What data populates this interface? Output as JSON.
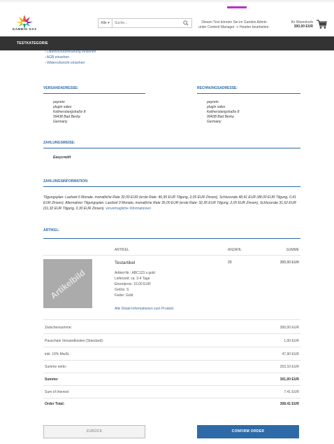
{
  "header": {
    "logo_text": "GAMBIO GX3",
    "search_category": "Alle ▾",
    "search_placeholder": "Suche...",
    "note_line1": "Diesen Text können Sie im Gambio Admin",
    "note_line2": "unter Content Manager -> Header bearbeiten.",
    "cart_label": "Ihr Warenkorb",
    "cart_total": "300,00 EUR"
  },
  "category_bar": {
    "label": "TESTKATEGORIE"
  },
  "links": [
    "Datenschutzerklärung einsehen",
    "AGB einsehen",
    "Widerrufsrecht einsehen"
  ],
  "shipping_address": {
    "heading": "VERSANDADRESSE:",
    "lines": [
      "payreto",
      "plugin sales",
      "Kellnersbergstraße 8",
      "99438 Bad Berka",
      "Germany"
    ]
  },
  "billing_address": {
    "heading": "RECHNUNGSADRESSE:",
    "lines": [
      "payreto",
      "plugin sales",
      "Kellnersbergstraße 8",
      "99438 Bad Berka",
      "Germany"
    ]
  },
  "payment": {
    "heading": "ZAHLUNGSWEISE:",
    "method": "Easycredit"
  },
  "payment_info": {
    "heading": "ZAHLUNGSINFORMATION:",
    "line1": "Tilgungsplan: Laufzeit 6 Monate, monatliche Rate 32,00 EUR (erste Rate: 46,95 EUR Tilgung, 2,05 EUR Zinsen), Schlussrate 48,41 EUR (48,00 EUR Tilgung, 0,41",
    "line2": "EUR Zinsen). Alternativer Tilgungsplan: Laufzeit 9 Monate, monatliche Rate 35,00 EUR (erste Rate: 32,95 EUR Tilgung, 2,05 EUR Zinsen), Schlussrate 31,62 EUR",
    "line3": "(31,32 EUR Tilgung, 0,30 EUR Zinsen).",
    "link": "vorvertragliche Informationen"
  },
  "articles": {
    "heading": "ARTIKEL:",
    "col_article": "ARTIKEL",
    "col_qty": "ANZAHL",
    "col_sum": "SUMME",
    "image_label": "Artikelbild",
    "name": "Testartikel",
    "meta": [
      "Artikel-Nr.: ABC123 s gold",
      "Lieferzeit: ca. 3-4 Tage",
      "Einzelpreis: 15,00 EUR",
      "Größe: S",
      "Farbe: Gold"
    ],
    "details_link": "Alle Detail-Informationen zum Produkt",
    "qty": "20",
    "price": "300,00 EUR"
  },
  "summary": [
    {
      "label": "Zwischensumme:",
      "value": "300,00 EUR",
      "bold": false
    },
    {
      "label": "Pauschale Versandkosten (Standard):",
      "value": "1,00 EUR",
      "bold": false
    },
    {
      "label": "inkl. 19% MwSt.:",
      "value": "47,90 EUR",
      "bold": false
    },
    {
      "label": "Summe netto:",
      "value": "253,10 EUR",
      "bold": false
    },
    {
      "label": "Summe:",
      "value": "301,00 EUR",
      "bold": true
    },
    {
      "label": "Sum of Interest:",
      "value": "7.41 EUR",
      "bold": false
    },
    {
      "label": "Order Total:",
      "value": "308.41 EUR",
      "bold": true
    }
  ],
  "buttons": {
    "back": "ZURÜCK",
    "confirm": "CONFIRM ORDER"
  },
  "colors": {
    "accent": "#2d6aa7",
    "category_bar": "#333333",
    "top_accent": "#b832c9"
  }
}
